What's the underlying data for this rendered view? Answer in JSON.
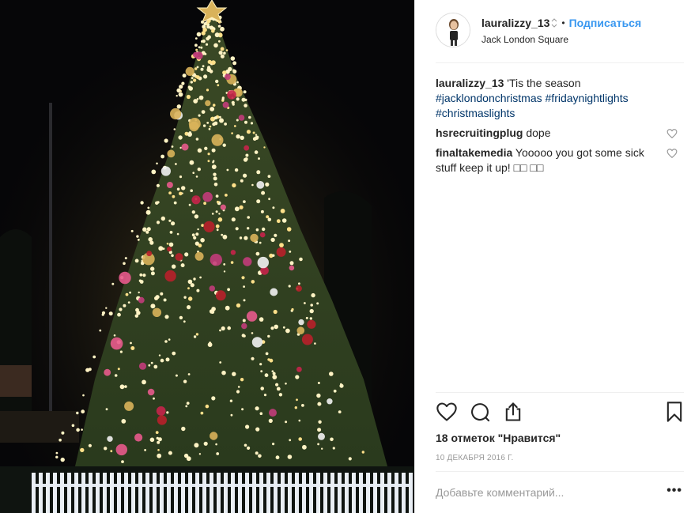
{
  "post": {
    "username": "lauralizzy_13",
    "follow_label": "Подписаться",
    "location": "Jack London Square",
    "avatar_icon": "bitmoji-avatar-icon"
  },
  "comments": [
    {
      "username": "lauralizzy_13",
      "text": "'Tis the season",
      "hashtags": [
        "#jacklondonchristmas",
        "#fridaynightlights",
        "#christmaslights"
      ]
    },
    {
      "username": "hsrecruitingplug",
      "text": "dope"
    },
    {
      "username": "finaltakemedia",
      "text": "Yooooo you got some sick stuff keep it up! □□ □□"
    }
  ],
  "actions": {
    "like_icon": "heart-icon",
    "comment_icon": "speech-bubble-icon",
    "share_icon": "share-icon",
    "save_icon": "bookmark-icon"
  },
  "likes_text": "18 отметок \"Нравится\"",
  "date_text": "10 ДЕКАБРЯ 2016 Г.",
  "add_comment": {
    "placeholder": "Добавьте комментарий...",
    "more_label": "•••"
  },
  "colors": {
    "link": "#3897f0",
    "hashtag": "#003569",
    "text": "#262626",
    "muted": "#999999"
  }
}
